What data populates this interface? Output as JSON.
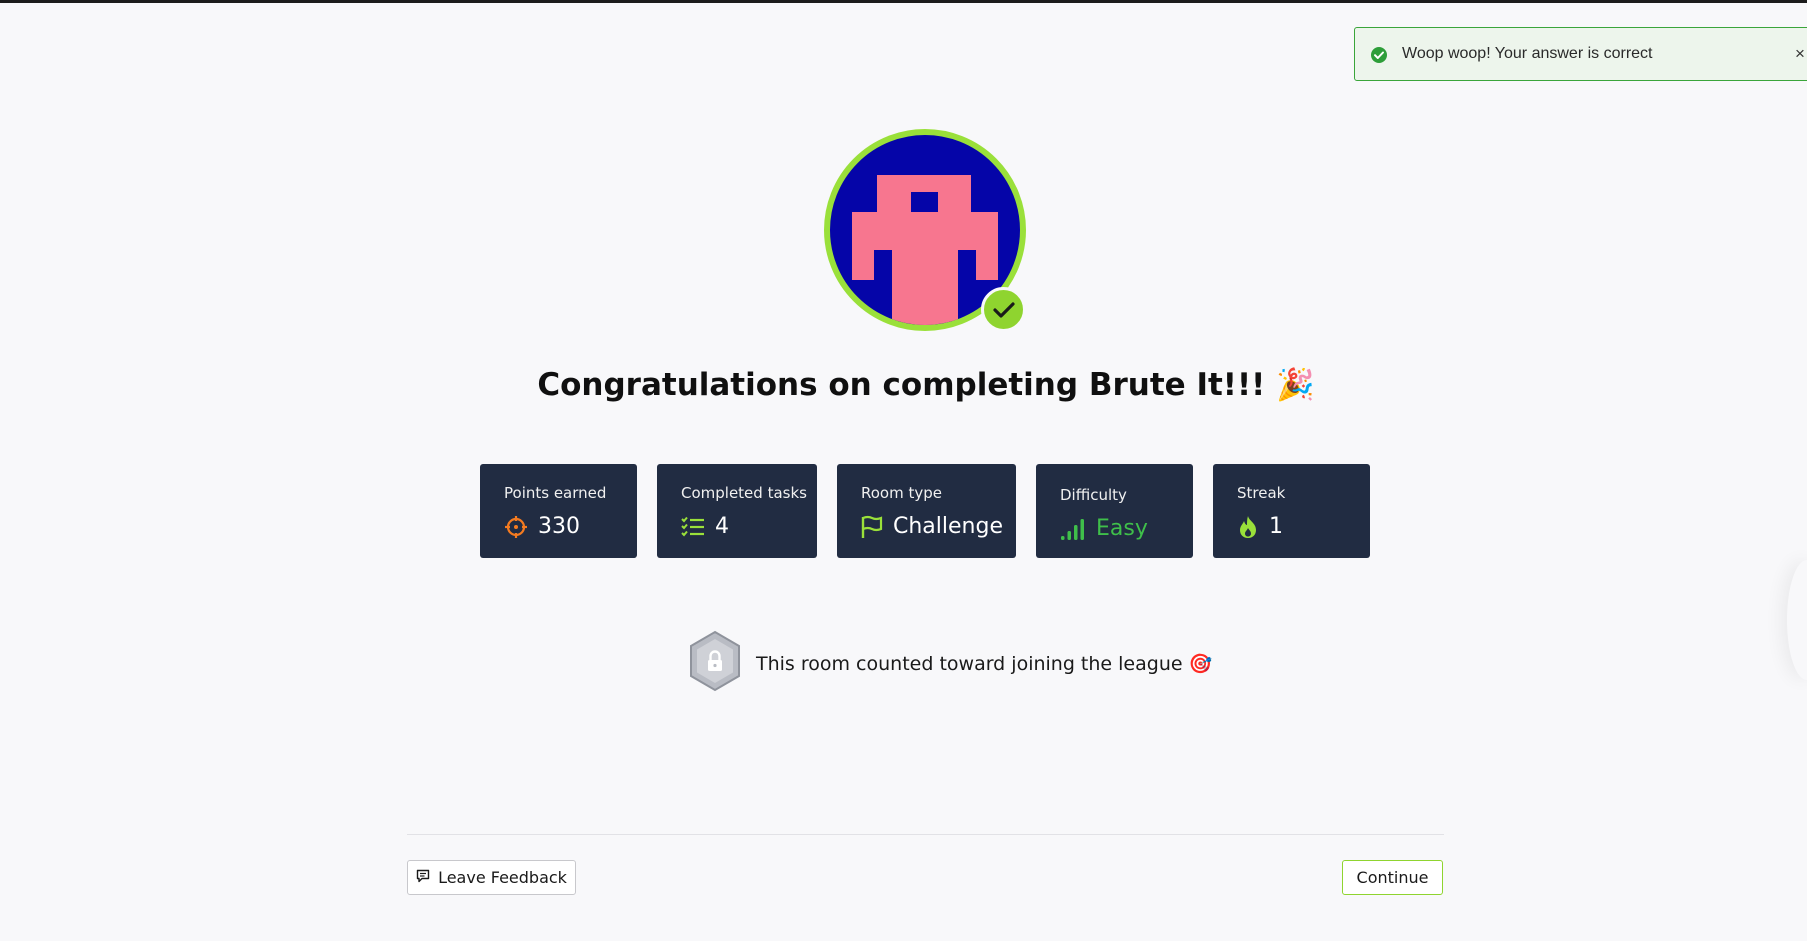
{
  "toast": {
    "message": "Woop woop! Your answer is correct",
    "close_symbol": "×",
    "icon": "check-circle-icon",
    "color": "#3aa53a"
  },
  "avatar": {
    "ring_color": "#9ae03a",
    "background_color": "#0505a8",
    "figure_color": "#f7768f",
    "badge_icon": "checkmark-icon"
  },
  "heading": {
    "text": "Congratulations on completing Brute It!!!",
    "emoji": "🎉"
  },
  "stats": [
    {
      "label": "Points earned",
      "value": "330",
      "icon": "target-icon",
      "icon_color": "#f47b20"
    },
    {
      "label": "Completed tasks",
      "value": "4",
      "icon": "checklist-icon",
      "icon_color": "#9ae03a"
    },
    {
      "label": "Room type",
      "value": "Challenge",
      "icon": "flag-icon",
      "icon_color": "#9ae03a"
    },
    {
      "label": "Difficulty",
      "value": "Easy",
      "icon": "signal-bars-icon",
      "icon_color": "#3fbf4a"
    },
    {
      "label": "Streak",
      "value": "1",
      "icon": "flame-icon",
      "icon_color": "#9ae03a"
    }
  ],
  "league": {
    "text": "This room counted toward joining the league",
    "emoji": "🎯",
    "icon": "lock-hexagon-badge-icon"
  },
  "footer": {
    "feedback_label": "Leave Feedback",
    "continue_label": "Continue",
    "accent_color": "#8fd42f"
  }
}
